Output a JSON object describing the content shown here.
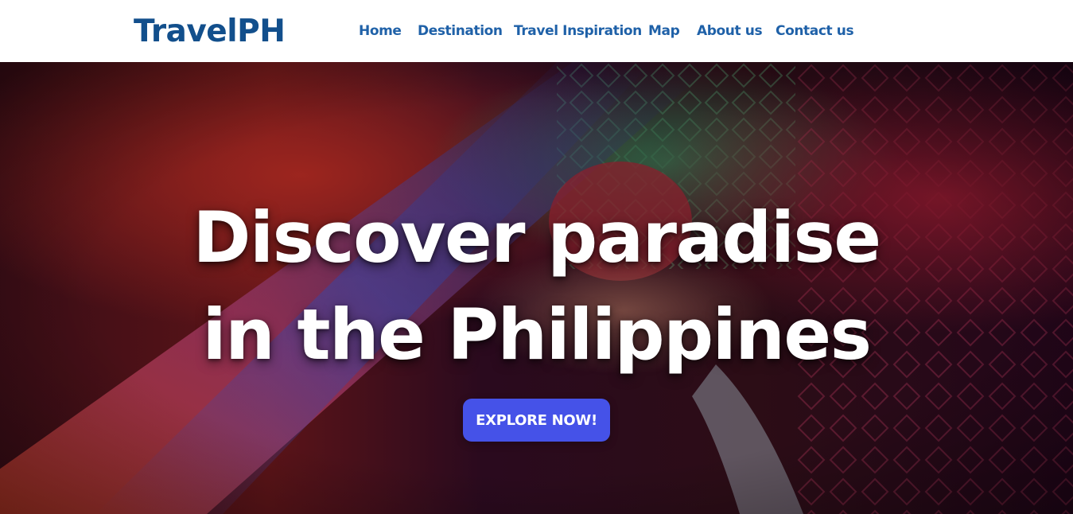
{
  "brand": {
    "name": "TravelPH"
  },
  "nav": {
    "items": [
      {
        "label": "Home"
      },
      {
        "label": "Destination"
      },
      {
        "label": "Travel Inspiration"
      },
      {
        "label": "Map"
      },
      {
        "label": "About us"
      },
      {
        "label": "Contact us"
      }
    ]
  },
  "hero": {
    "title_line1": "Discover paradise",
    "title_line2": "in the Philippines",
    "cta_label": "EXPLORE NOW!"
  },
  "colors": {
    "brand": "#124f8c",
    "nav_link": "#1f61a8",
    "cta": "#4552e8",
    "hero_text": "#ffffff"
  }
}
